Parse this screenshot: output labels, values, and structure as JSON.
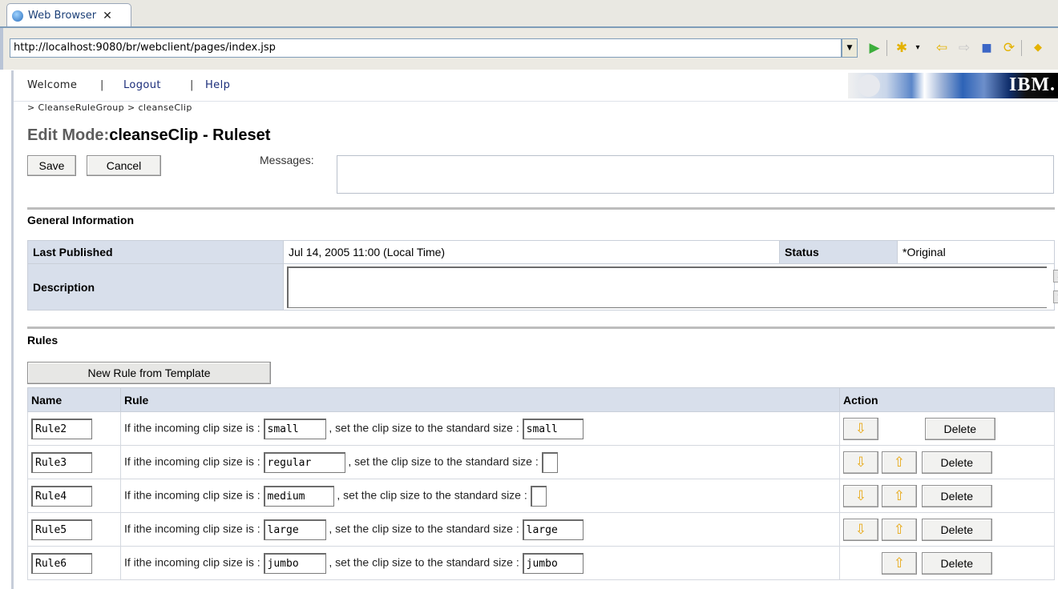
{
  "browser": {
    "tab_title": "Web Browser",
    "tab_close": "✕",
    "url": "http://localhost:9080/br/webclient/pages/index.jsp"
  },
  "nav": {
    "welcome": "Welcome",
    "separator": "|",
    "logout": "Logout",
    "help": "Help",
    "brand": "IBM."
  },
  "breadcrumb": "> CleanseRuleGroup > cleanseClip",
  "title": {
    "mode": "Edit Mode:",
    "name": "cleanseClip - Ruleset"
  },
  "actions": {
    "save": "Save",
    "cancel": "Cancel",
    "messages_label": "Messages:"
  },
  "general": {
    "heading": "General Information",
    "last_published_label": "Last Published",
    "last_published_value": "Jul 14, 2005 11:00 (Local Time)",
    "status_label": "Status",
    "status_value": "*Original",
    "description_label": "Description",
    "description_value": ""
  },
  "rules": {
    "heading": "Rules",
    "new_rule_button": "New Rule from Template",
    "columns": {
      "name": "Name",
      "rule": "Rule",
      "action": "Action"
    },
    "text_before": "If ithe incoming clip size is :",
    "text_after": ", set the clip size to the standard size :",
    "delete_label": "Delete",
    "rows": [
      {
        "name": "Rule2",
        "incoming": "small",
        "standard": "small"
      },
      {
        "name": "Rule3",
        "incoming": "regular",
        "standard": ""
      },
      {
        "name": "Rule4",
        "incoming": "medium",
        "standard": ""
      },
      {
        "name": "Rule5",
        "incoming": "large",
        "standard": "large"
      },
      {
        "name": "Rule6",
        "incoming": "jumbo",
        "standard": "jumbo"
      }
    ]
  },
  "colors": {
    "header_bg": "#d8dfeb",
    "link": "#1b2d7a",
    "arrow": "#e8a814"
  }
}
